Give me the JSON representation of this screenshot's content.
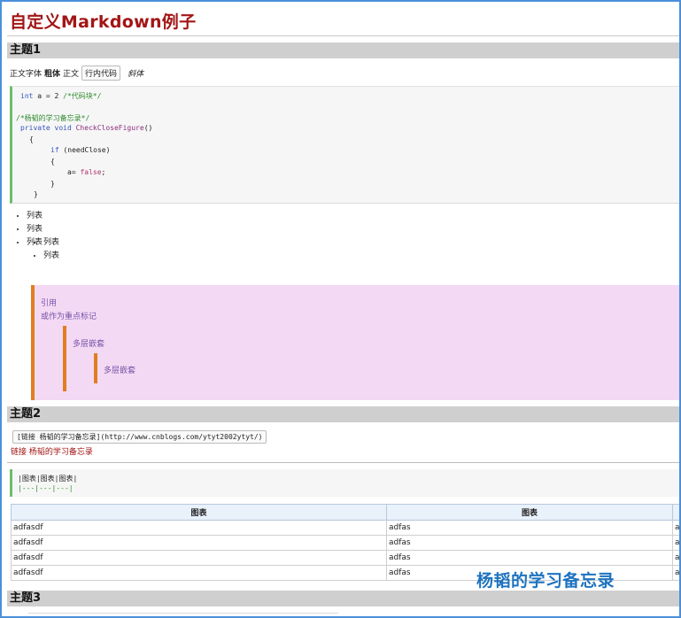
{
  "page": {
    "title": "自定义Markdown例子"
  },
  "sections": {
    "s1": "主题1",
    "s2": "主题2",
    "s3": "主题3"
  },
  "inline": {
    "normal": "正文字体",
    "bold": "粗体",
    "normal2": "正文",
    "code": "行内代码",
    "italic": "斜体"
  },
  "code_block": {
    "line1_kw": "int",
    "line1_rest": " a = 2 ",
    "line1_cm": "/*代码块*/",
    "line2_cm": "/*杨韬的学习备忘录*/",
    "line3_kw": "private void",
    "line3_fn": " CheckCloseFigure",
    "line3_rest": "()",
    "brace_open": "{",
    "line5_kw": "if",
    "line5_rest": " (needClose)",
    "line6": "{",
    "line7_rest": "a= ",
    "line7_str": "false",
    "line7_end": ";",
    "line8": "}",
    "line9": "}"
  },
  "list": {
    "item1": "列表",
    "item2": "列表",
    "sub1": "列表",
    "sub2": "列表",
    "item3": "列表"
  },
  "quote": {
    "line1": "引用",
    "line2": "或作为重点标记",
    "nested1": "多层嵌套",
    "nested2": "多层嵌套"
  },
  "link": {
    "code": "[链接 杨韬的学习备忘录](http://www.cnblogs.com/ytyt2002ytyt/)",
    "rendered": "链接 杨韬的学习备忘录"
  },
  "table_code": {
    "line1": "|图表|图表|图表|",
    "line2": "|---|---|---|"
  },
  "table": {
    "headers": [
      "图表",
      "图表",
      ""
    ],
    "rows": [
      [
        "adfasdf",
        "adfas",
        "a"
      ],
      [
        "adfasdf",
        "adfas",
        "a"
      ],
      [
        "adfasdf",
        "adfas",
        "a"
      ],
      [
        "adfasdf",
        "adfas",
        "a"
      ]
    ]
  },
  "watermark": "杨韬的学习备忘录",
  "colors": {
    "title": "#a31515",
    "accent_green": "#6abf69",
    "quote_bg": "#f3d9f4",
    "quote_bar": "#e07e20",
    "watermark": "#1e73c0"
  }
}
